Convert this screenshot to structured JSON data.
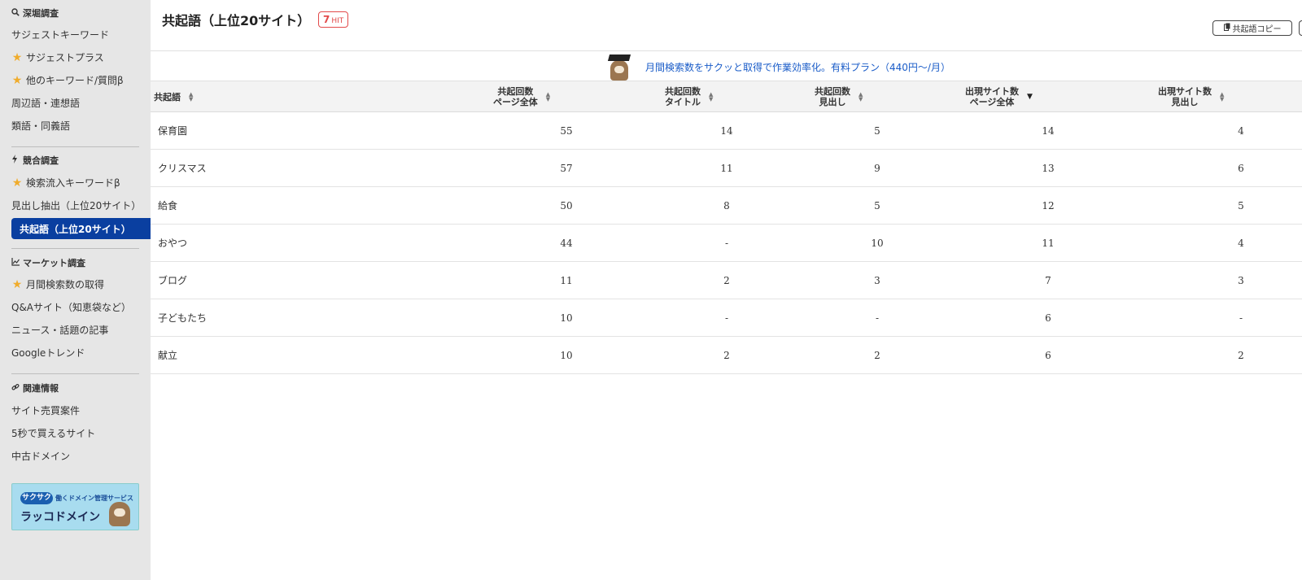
{
  "sidebar": {
    "sections": [
      {
        "icon": "search-icon",
        "title": "深堀調査"
      },
      {
        "icon": "lightning-icon",
        "title": "競合調査"
      },
      {
        "icon": "chart-icon",
        "title": "マーケット調査"
      },
      {
        "icon": "link-icon",
        "title": "関連情報"
      }
    ],
    "deep": [
      "サジェストキーワード",
      "サジェストプラス",
      "他のキーワード/質問β",
      "周辺語・連想語",
      "類語・同義語"
    ],
    "competitor": [
      "検索流入キーワードβ",
      "見出し抽出（上位20サイト）",
      "共起語（上位20サイト）"
    ],
    "market": [
      "月間検索数の取得",
      "Q&Aサイト（知恵袋など）",
      "ニュース・話題の記事",
      "Googleトレンド"
    ],
    "related": [
      "サイト売買案件",
      "5秒で買えるサイト",
      "中古ドメイン"
    ],
    "banner": {
      "tag": "サクサク",
      "sub": "働くドメイン管理サービス",
      "title": "ラッコドメイン"
    }
  },
  "header": {
    "title": "共起語（上位20サイト）",
    "hit_count": "7",
    "hit_unit": "HIT",
    "copy_button": "共起語コピー"
  },
  "promo": {
    "text": "月間検索数をサクッと取得で作業効率化。有料プラン（440円〜/月）"
  },
  "table": {
    "columns": [
      {
        "line1": "共起語",
        "line2": "",
        "sort": "none"
      },
      {
        "line1": "共起回数",
        "line2": "ページ全体",
        "sort": "none"
      },
      {
        "line1": "共起回数",
        "line2": "タイトル",
        "sort": "none"
      },
      {
        "line1": "共起回数",
        "line2": "見出し",
        "sort": "none"
      },
      {
        "line1": "出現サイト数",
        "line2": "ページ全体",
        "sort": "desc"
      },
      {
        "line1": "出現サイト数",
        "line2": "見出し",
        "sort": "none"
      }
    ],
    "rows": [
      {
        "word": "保育園",
        "c_page": "55",
        "c_title": "14",
        "c_head": "5",
        "s_page": "14",
        "s_head": "4"
      },
      {
        "word": "クリスマス",
        "c_page": "57",
        "c_title": "11",
        "c_head": "9",
        "s_page": "13",
        "s_head": "6"
      },
      {
        "word": "給食",
        "c_page": "50",
        "c_title": "8",
        "c_head": "5",
        "s_page": "12",
        "s_head": "5"
      },
      {
        "word": "おやつ",
        "c_page": "44",
        "c_title": "-",
        "c_head": "10",
        "s_page": "11",
        "s_head": "4"
      },
      {
        "word": "ブログ",
        "c_page": "11",
        "c_title": "2",
        "c_head": "3",
        "s_page": "7",
        "s_head": "3"
      },
      {
        "word": "子どもたち",
        "c_page": "10",
        "c_title": "-",
        "c_head": "-",
        "s_page": "6",
        "s_head": "-"
      },
      {
        "word": "献立",
        "c_page": "10",
        "c_title": "2",
        "c_head": "2",
        "s_page": "6",
        "s_head": "2"
      }
    ]
  },
  "colors": {
    "active_nav": "#0a3fa0",
    "star": "#f0ac2c",
    "hit_badge": "#e24a4a",
    "promo_link": "#1a5cc8"
  }
}
